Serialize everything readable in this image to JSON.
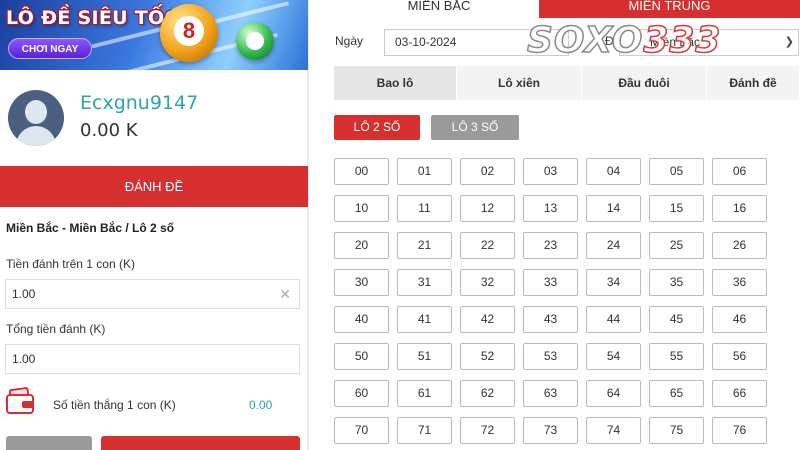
{
  "banner": {
    "title": "LÔ ĐỀ SIÊU TỐC",
    "cta_label": "CHƠI NGAY",
    "ball_number": "8"
  },
  "user": {
    "username": "Ecxgnu9147",
    "balance": "0.00 K"
  },
  "bet_bar": {
    "label": "ĐÁNH ĐỀ"
  },
  "form": {
    "breadcrumb": "Miền Bắc - Miền Bắc / Lô 2 số",
    "stake_label": "Tiền đánh trên 1 con (K)",
    "stake_value": "1.00",
    "clear_icon": "close-icon",
    "total_label": "Tổng tiền đánh (K)",
    "total_value": "1.00",
    "win_label": "Số tiền thắng 1 con (K)",
    "win_value": "0.00"
  },
  "regions": {
    "north": "MIỀN BẮC",
    "central": "MIỀN TRUNG"
  },
  "filters": {
    "date_label": "Ngày",
    "date_value": "03-10-2024",
    "station_label_partial": "Đ",
    "station_value_partial": "Miền Bắc"
  },
  "logo": {
    "part1": "SOXO",
    "part2": "333"
  },
  "type_tabs": [
    "Bao lô",
    "Lô xiên",
    "Đầu đuôi",
    "Đánh đề"
  ],
  "sub_tabs": [
    "LÔ 2 SỐ",
    "LÔ 3 SỐ"
  ],
  "numbers": [
    [
      "00",
      "01",
      "02",
      "03",
      "04",
      "05",
      "06"
    ],
    [
      "10",
      "11",
      "12",
      "13",
      "14",
      "15",
      "16"
    ],
    [
      "20",
      "21",
      "22",
      "23",
      "24",
      "25",
      "26"
    ],
    [
      "30",
      "31",
      "32",
      "33",
      "34",
      "35",
      "36"
    ],
    [
      "40",
      "41",
      "42",
      "43",
      "44",
      "45",
      "46"
    ],
    [
      "50",
      "51",
      "52",
      "53",
      "54",
      "55",
      "56"
    ],
    [
      "60",
      "61",
      "62",
      "63",
      "64",
      "65",
      "66"
    ],
    [
      "70",
      "71",
      "72",
      "73",
      "74",
      "75",
      "76"
    ]
  ],
  "colors": {
    "accent_red": "#d62f2f",
    "teal": "#2aa6a6",
    "grey_button": "#9a9a9a"
  }
}
